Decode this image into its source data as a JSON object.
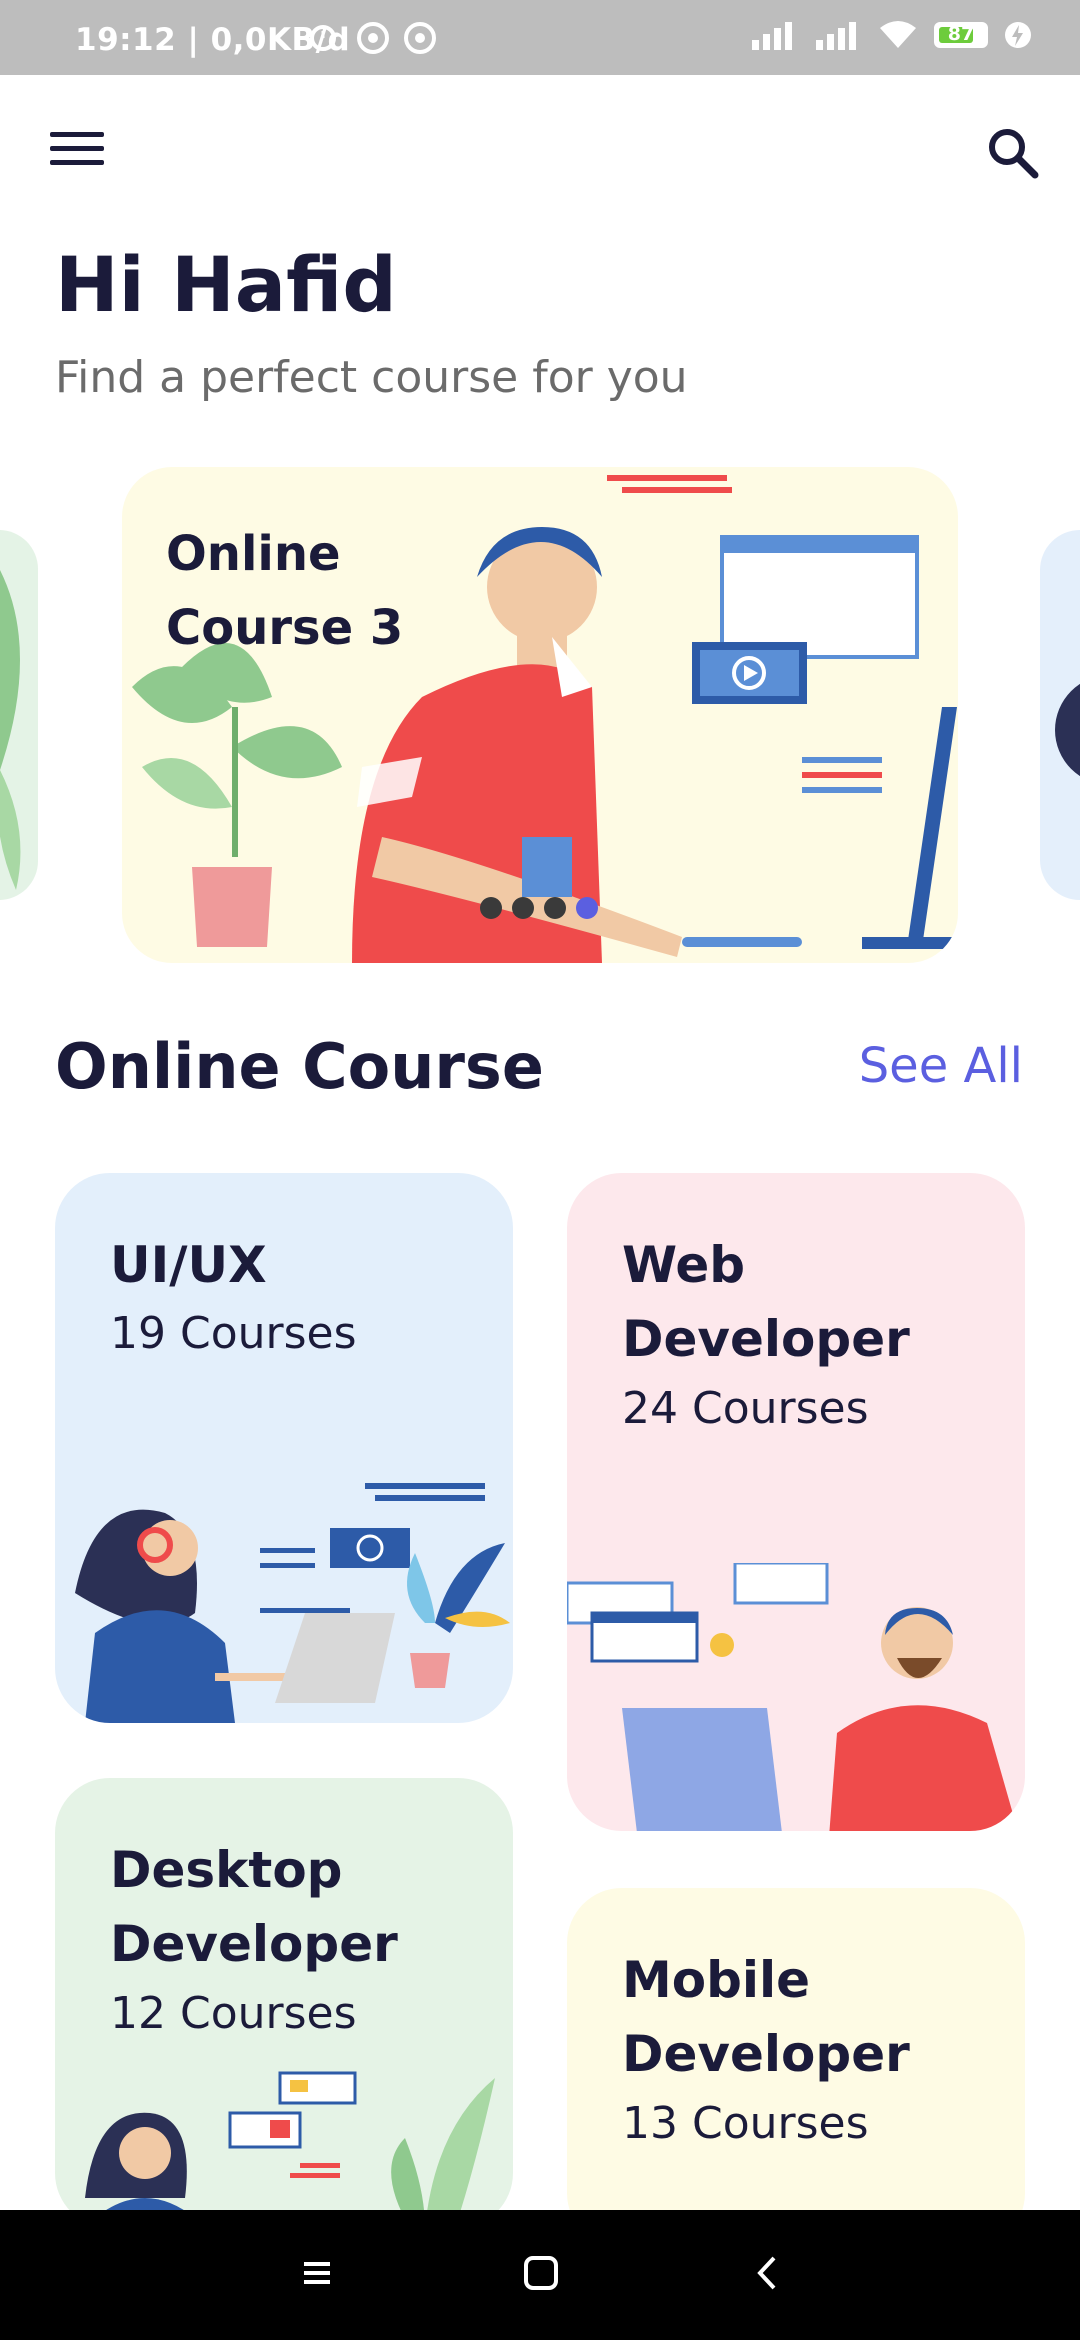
{
  "status_bar": {
    "time": "19:12 | 0,0KB/d",
    "battery_level": "87"
  },
  "header": {
    "greeting": "Hi Hafid",
    "subtitle": "Find a perfect course for you"
  },
  "carousel": {
    "active_title": "Online Course 3",
    "page_count": 4,
    "active_index": 3
  },
  "section": {
    "title": "Online Course",
    "see_all": "See All"
  },
  "courses": [
    {
      "title": "UI/UX",
      "count": "19 Courses"
    },
    {
      "title": "Web Developer",
      "count": "24 Courses"
    },
    {
      "title": "Desktop Developer",
      "count": "12 Courses"
    },
    {
      "title": "Mobile Developer",
      "count": "13 Courses"
    }
  ],
  "colors": {
    "accent": "#5b5fe0",
    "text_dark": "#1b1b3a",
    "card_blue": "#e3effb",
    "card_pink": "#fde8ec",
    "card_green": "#e5f3e6",
    "card_yellow": "#fefbe4"
  }
}
